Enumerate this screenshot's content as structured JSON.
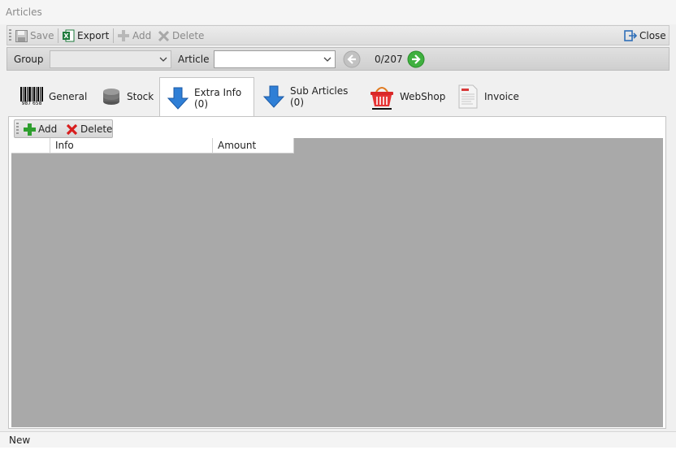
{
  "window": {
    "title": "Articles"
  },
  "toolbar": {
    "save_label": "Save",
    "export_label": "Export",
    "add_label": "Add",
    "delete_label": "Delete",
    "close_label": "Close"
  },
  "filter": {
    "group_label": "Group",
    "group_value": "",
    "article_label": "Article",
    "article_value": "",
    "counter": "0/207"
  },
  "tabs": [
    {
      "label": "General",
      "icon": "barcode-icon",
      "barcode_text": "987 658"
    },
    {
      "label": "Stock",
      "icon": "database-icon"
    },
    {
      "label": "Extra Info (0)",
      "icon": "arrow-down-icon",
      "active": true
    },
    {
      "label": "Sub Articles (0)",
      "icon": "arrow-down-icon"
    },
    {
      "label": "WebShop",
      "icon": "basket-icon"
    },
    {
      "label": "Invoice",
      "icon": "invoice-icon"
    }
  ],
  "subtoolbar": {
    "add_label": "Add",
    "delete_label": "Delete"
  },
  "grid": {
    "columns": [
      "Info",
      "Amount"
    ]
  },
  "status": {
    "text": "New"
  },
  "colors": {
    "accent_green": "#2e9e2e",
    "delete_red": "#d81e1e",
    "arrow_blue": "#2f7fd6",
    "grid_bg": "#a9a9a9"
  }
}
